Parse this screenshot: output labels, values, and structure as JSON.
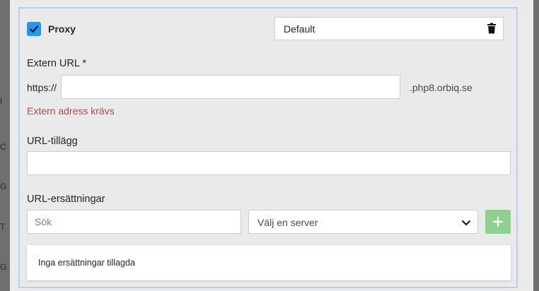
{
  "proxy": {
    "label": "Proxy",
    "checked": true,
    "selected_value": "Default"
  },
  "extern_url": {
    "label": "Extern URL *",
    "prefix": "https://",
    "value": "",
    "suffix": ".php8.orbiq.se",
    "error": "Extern adress krävs"
  },
  "url_suffix": {
    "label": "URL-tillägg",
    "value": ""
  },
  "url_replacements": {
    "label": "URL-ersättningar",
    "search_placeholder": "Sök",
    "server_select_value": "Välj en server",
    "empty_text": "Inga ersättningar tillagda"
  },
  "backdrop_letters": [
    "I",
    "C",
    "G",
    "T",
    "G"
  ],
  "colors": {
    "checkbox": "#2196f3",
    "error": "#b14a4a",
    "add_button": "#8fcf8f",
    "panel_border": "#b7d0f1"
  },
  "icons": {
    "checkbox": "check-icon",
    "delete": "trash-icon",
    "dropdown": "chevron-down-icon",
    "add": "plus-icon"
  }
}
